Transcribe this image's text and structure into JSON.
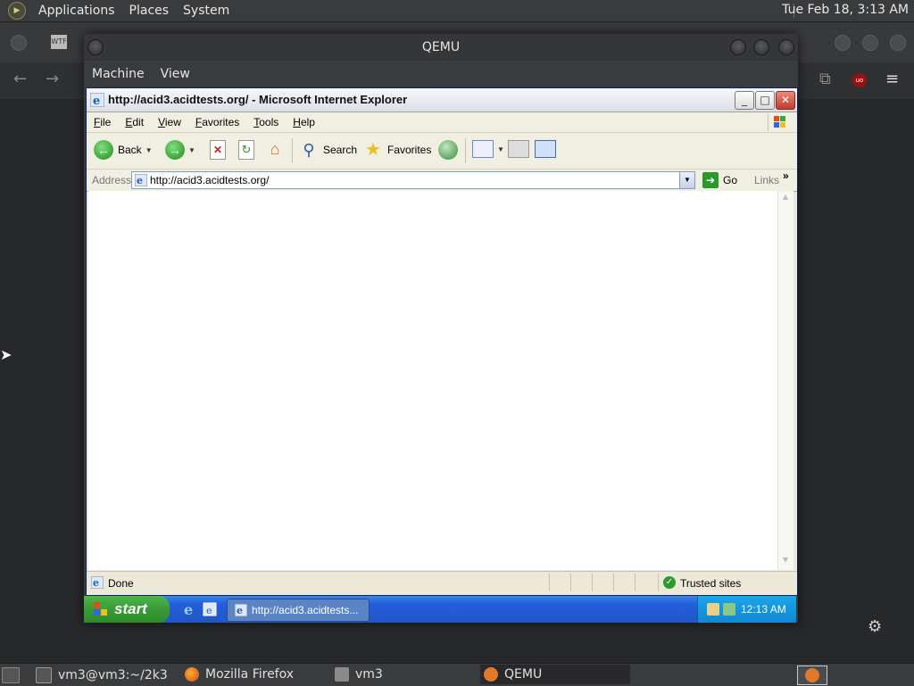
{
  "top_panel": {
    "menus": [
      "Applications",
      "Places",
      "System"
    ],
    "clock": "Tue Feb 18,  3:13 AM"
  },
  "qemu": {
    "title": "QEMU",
    "menus": [
      "Machine",
      "View"
    ]
  },
  "ie": {
    "title": "http://acid3.acidtests.org/ - Microsoft Internet Explorer",
    "menus": [
      {
        "label": "File",
        "accel": "F",
        "rest": "ile"
      },
      {
        "label": "Edit",
        "accel": "E",
        "rest": "dit"
      },
      {
        "label": "View",
        "accel": "V",
        "rest": "iew"
      },
      {
        "label": "Favorites",
        "accel": "F",
        "rest": "avorites"
      },
      {
        "label": "Tools",
        "accel": "T",
        "rest": "ools"
      },
      {
        "label": "Help",
        "accel": "H",
        "rest": "elp"
      }
    ],
    "toolbar": {
      "back": "Back",
      "search": "Search",
      "favorites": "Favorites"
    },
    "address": {
      "label": "Address",
      "url": "http://acid3.acidtests.org/",
      "go": "Go",
      "links": "Links"
    },
    "status": {
      "text": "Done",
      "zone": "Trusted sites"
    }
  },
  "xp_taskbar": {
    "start": "start",
    "task": "http://acid3.acidtests...",
    "time": "12:13 AM"
  },
  "bottom_panel": {
    "items": [
      {
        "label": "vm3@vm3:~/2k3"
      },
      {
        "label": "Mozilla Firefox"
      },
      {
        "label": "vm3"
      },
      {
        "label": "QEMU"
      }
    ]
  },
  "colors": {
    "xp_blue": "#245edb",
    "xp_start_green": "#3a9a36",
    "ie_close_red": "#c43c2a"
  }
}
